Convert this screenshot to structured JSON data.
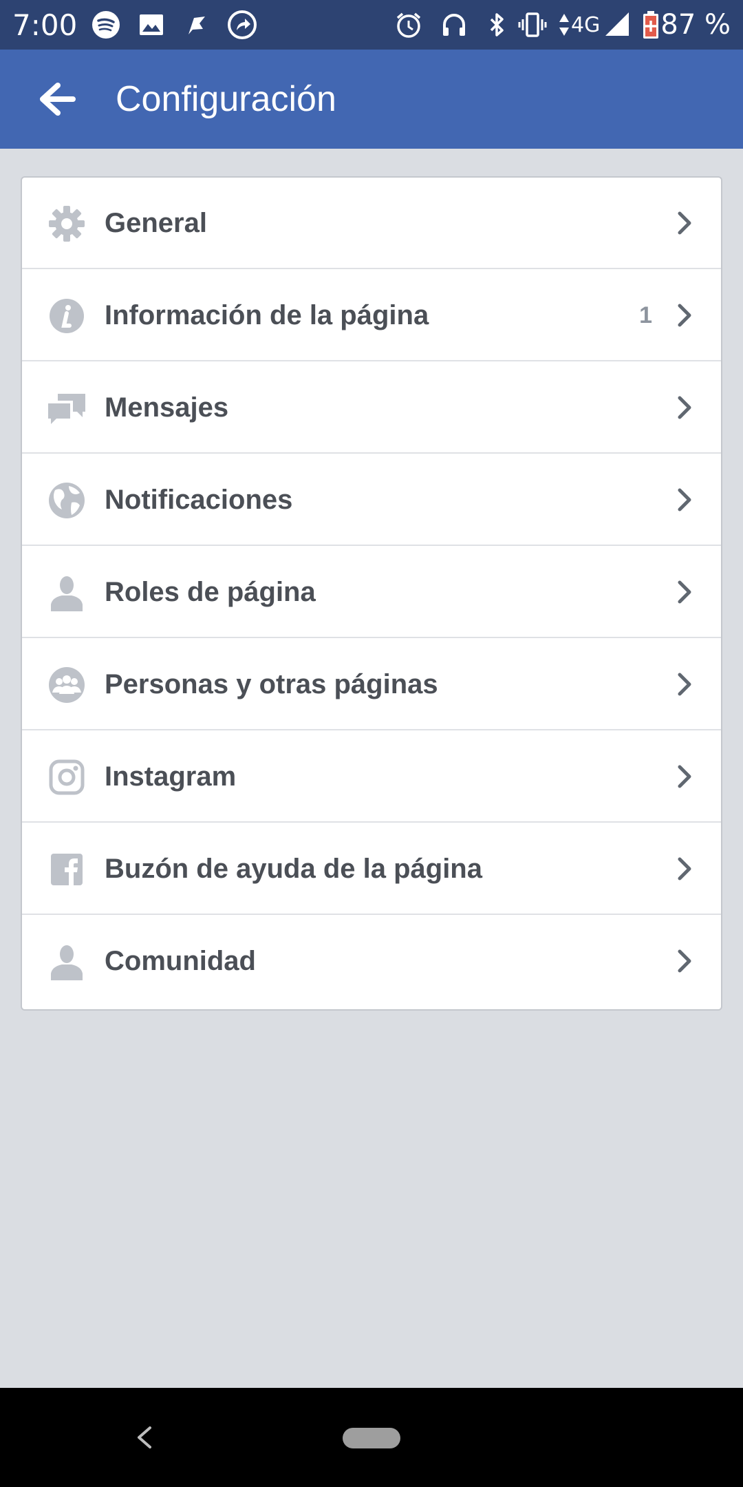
{
  "status_bar": {
    "time": "7:00",
    "network": "4G",
    "battery": "87 %",
    "left_icons": [
      "spotify-icon",
      "gallery-icon",
      "flag-icon",
      "share-app-icon"
    ],
    "right_icons": [
      "alarm-icon",
      "headphones-icon",
      "bluetooth-icon",
      "vibrate-icon",
      "data-arrows-icon",
      "signal-icon",
      "battery-icon"
    ]
  },
  "app_bar": {
    "title": "Configuración",
    "back_icon": "arrow-left-icon"
  },
  "settings": {
    "items": [
      {
        "label": "General",
        "icon": "gear-icon",
        "badge": ""
      },
      {
        "label": "Información de la página",
        "icon": "info-icon",
        "badge": "1"
      },
      {
        "label": "Mensajes",
        "icon": "chat-bubbles-icon",
        "badge": ""
      },
      {
        "label": "Notificaciones",
        "icon": "globe-icon",
        "badge": ""
      },
      {
        "label": "Roles de página",
        "icon": "person-icon",
        "badge": ""
      },
      {
        "label": "Personas y otras páginas",
        "icon": "people-icon",
        "badge": ""
      },
      {
        "label": "Instagram",
        "icon": "instagram-icon",
        "badge": ""
      },
      {
        "label": "Buzón de ayuda de la página",
        "icon": "facebook-icon",
        "badge": ""
      },
      {
        "label": "Comunidad",
        "icon": "person-icon",
        "badge": ""
      }
    ]
  },
  "colors": {
    "status_bar": "#2d4372",
    "app_bar": "#4267b2",
    "background": "#dadde2",
    "label_text": "#4b4f56",
    "icon_gray": "#bec2c9",
    "chevron": "#606770"
  }
}
